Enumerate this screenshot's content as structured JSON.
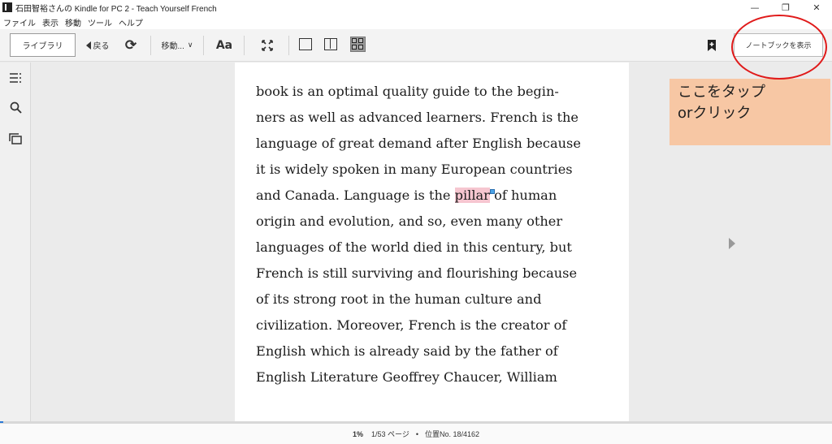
{
  "window": {
    "title": "石田智裕さんの Kindle for PC 2 - Teach Yourself French",
    "minimize": "—",
    "restore": "❐",
    "close": "✕"
  },
  "menu": [
    "ファイル",
    "表示",
    "移動",
    "ツール",
    "ヘルプ"
  ],
  "toolbar": {
    "library": "ライブラリ",
    "back": "戻る",
    "goto": "移動...",
    "font": "Aa",
    "notebook": "ノートブックを表示"
  },
  "page": {
    "lines": [
      "book is an optimal quality guide to the begin-",
      "ners as well as advanced learners. French is the",
      "language of great demand after English because",
      "it is widely spoken in many European countries",
      "and Canada. Language is the ",
      "origin and evolution, and so, even many other",
      "languages of the world died in this century, but",
      "French is still surviving and flourishing because",
      "of its strong root in the human culture and",
      "civilization. Moreover, French is the creator of",
      "English which is already said by the father of",
      "English Literature Geoffrey Chaucer, William"
    ],
    "highlight_word": "pillar",
    "after_highlight": " of human"
  },
  "annotation": {
    "line1": "ここをタップ",
    "line2": "orクリック",
    "color": "#f7c7a4",
    "circle_color": "#e01a1a"
  },
  "status": {
    "percent": "1%",
    "pages": "1/53 ページ",
    "dot": "•",
    "location": "位置No. 18/4162",
    "progress_fraction": 0.01
  },
  "icons": {
    "sidebar": [
      "toc-icon",
      "search-icon",
      "flashcards-icon"
    ],
    "toolbar": [
      "back-arrow-icon",
      "sync-icon",
      "chevron-down-icon",
      "fullscreen-icon",
      "single-column-icon",
      "two-column-icon",
      "grid-view-icon",
      "bookmark-add-icon"
    ]
  }
}
